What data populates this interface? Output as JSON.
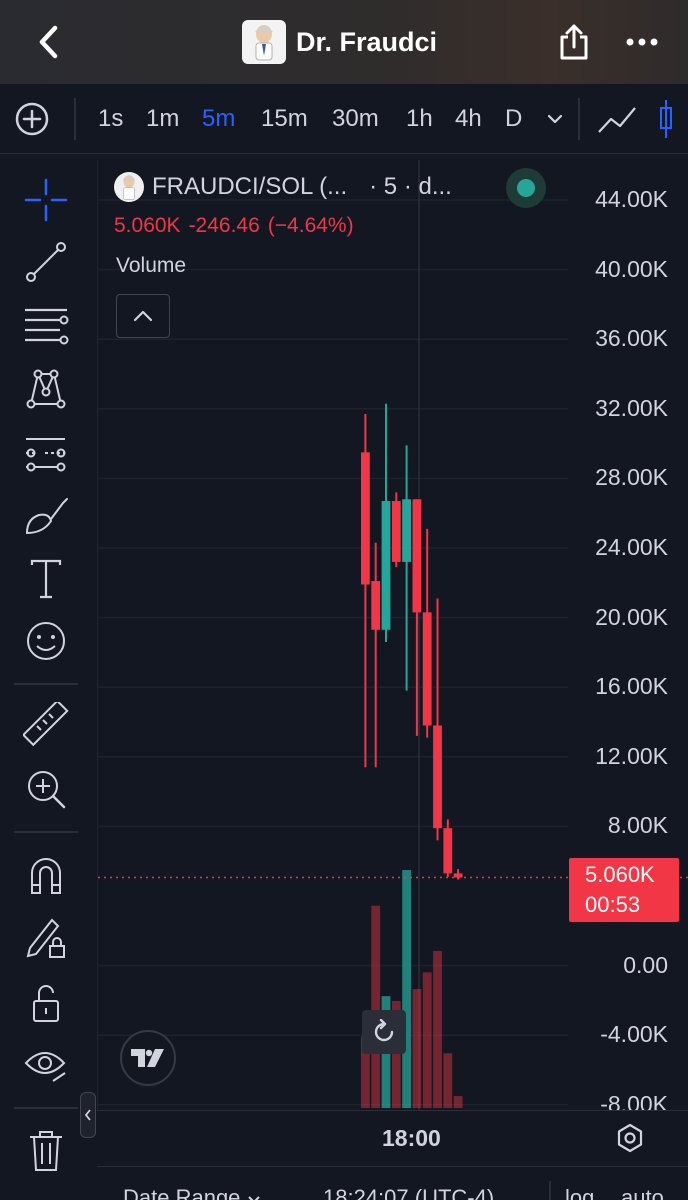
{
  "header": {
    "title": "Dr. Fraudci",
    "back_icon": "chevron-left-icon",
    "share_icon": "share-icon",
    "more_icon": "more-dots-icon"
  },
  "timeframes": [
    "1s",
    "1m",
    "5m",
    "15m",
    "30m",
    "1h",
    "4h",
    "D"
  ],
  "active_timeframe": "5m",
  "left_tools": [
    "crosshair-icon",
    "trend-line-icon",
    "fib-lines-icon",
    "pattern-icon",
    "forecast-icon",
    "brush-icon",
    "text-icon",
    "emoji-icon",
    "ruler-icon",
    "zoom-in-icon",
    "magnet-icon",
    "lock-drawings-icon",
    "unlock-icon",
    "eye-icon",
    "trash-icon"
  ],
  "legend": {
    "symbol": "FRAUDCI/SOL (...",
    "interval": "· 5 · d...",
    "last_price": "5.060K",
    "change": "-246.46",
    "change_pct": "(−4.64%)",
    "volume_label": "Volume"
  },
  "colors": {
    "up": "#26a69a",
    "down": "#f23645",
    "accent": "#2962ff",
    "background": "#131722"
  },
  "y_axis_labels": [
    "44.00K",
    "40.00K",
    "36.00K",
    "32.00K",
    "28.00K",
    "24.00K",
    "20.00K",
    "16.00K",
    "12.00K",
    "8.00K",
    "0.00",
    "-4.00K",
    "-8.00K"
  ],
  "price_tag": {
    "price": "5.060K",
    "countdown": "00:53"
  },
  "time_axis": {
    "label": "18:00"
  },
  "bottom_bar": {
    "date_range": "Date Range",
    "time": "18:24:07 (UTC-4)",
    "log": "log",
    "auto": "auto"
  },
  "chart_data": {
    "type": "candlestick",
    "y_unit": "price",
    "candles": [
      {
        "o": 29500,
        "h": 31700,
        "l": 11400,
        "c": 21900,
        "dir": "down"
      },
      {
        "o": 22100,
        "h": 24300,
        "l": 11400,
        "c": 19300,
        "dir": "down"
      },
      {
        "o": 19300,
        "h": 32300,
        "l": 18600,
        "c": 26700,
        "dir": "up"
      },
      {
        "o": 26700,
        "h": 27200,
        "l": 22900,
        "c": 23200,
        "dir": "down"
      },
      {
        "o": 23200,
        "h": 29900,
        "l": 15800,
        "c": 26800,
        "dir": "up"
      },
      {
        "o": 26800,
        "h": 26800,
        "l": 13200,
        "c": 20300,
        "dir": "down"
      },
      {
        "o": 20300,
        "h": 25100,
        "l": 13100,
        "c": 13800,
        "dir": "down"
      },
      {
        "o": 13800,
        "h": 21100,
        "l": 7200,
        "c": 7900,
        "dir": "down"
      },
      {
        "o": 7900,
        "h": 8400,
        "l": 5100,
        "c": 5300,
        "dir": "down"
      },
      {
        "o": 5300,
        "h": 5550,
        "l": 4950,
        "c": 5060,
        "dir": "down"
      }
    ],
    "volumes": [
      {
        "v": 0.3,
        "dir": "down"
      },
      {
        "v": 0.85,
        "dir": "down"
      },
      {
        "v": 0.47,
        "dir": "up"
      },
      {
        "v": 0.45,
        "dir": "down"
      },
      {
        "v": 1.0,
        "dir": "up"
      },
      {
        "v": 0.5,
        "dir": "down"
      },
      {
        "v": 0.57,
        "dir": "down"
      },
      {
        "v": 0.66,
        "dir": "down"
      },
      {
        "v": 0.23,
        "dir": "down"
      },
      {
        "v": 0.05,
        "dir": "down"
      }
    ],
    "last_price_value": 5060,
    "ylim": [
      -8000,
      44000
    ]
  }
}
